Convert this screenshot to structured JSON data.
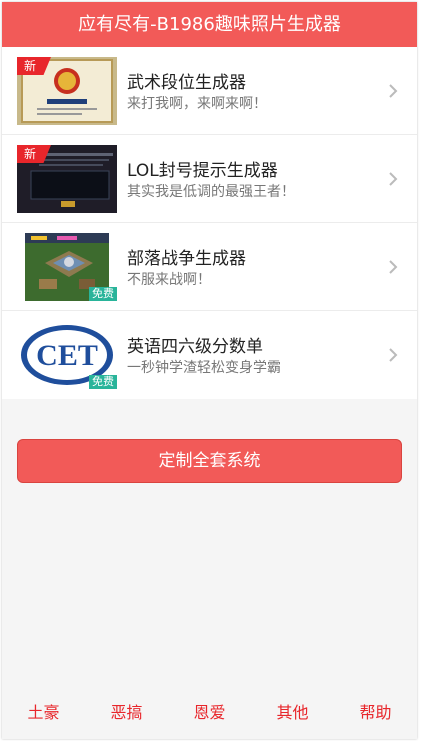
{
  "header": {
    "title": "应有尽有-B1986趣味照片生成器"
  },
  "items": [
    {
      "title": "武术段位生成器",
      "subtitle": "来打我啊，来啊来啊！",
      "badge": "新",
      "thumb_icon": "certificate-thumbnail"
    },
    {
      "title": "LOL封号提示生成器",
      "subtitle": "其实我是低调的最强王者！",
      "badge": "新",
      "thumb_icon": "game-dialog-thumbnail"
    },
    {
      "title": "部落战争生成器",
      "subtitle": "不服来战啊！",
      "badge": "免费",
      "thumb_icon": "village-map-thumbnail"
    },
    {
      "title": "英语四六级分数单",
      "subtitle": "一秒钟学渣轻松变身学霸",
      "badge": "免费",
      "thumb_icon": "cet-logo-thumbnail",
      "thumb_text": "CET"
    }
  ],
  "cta": {
    "label": "定制全套系统"
  },
  "bottom_nav": [
    "土豪",
    "恶搞",
    "恩爱",
    "其他",
    "帮助"
  ],
  "colors": {
    "accent": "#f25a58",
    "new_badge": "#e8262b",
    "free_badge": "#29b49a"
  }
}
